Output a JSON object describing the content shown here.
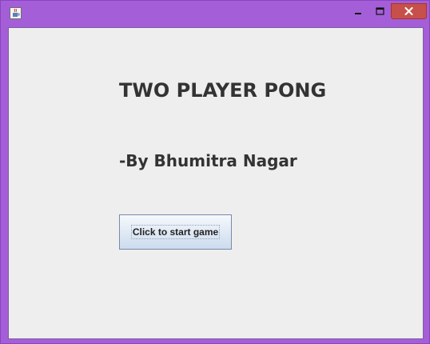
{
  "window": {
    "title": "",
    "icon": "java-cup-icon",
    "controls": {
      "minimize_glyph": "–",
      "maximize_glyph": "□",
      "close_glyph": "✕"
    }
  },
  "main": {
    "heading": "TWO PLAYER PONG",
    "author": "-By Bhumitra Nagar",
    "start_button_label": "Click to start game"
  },
  "colors": {
    "window_frame": "#a45fd8",
    "close_button": "#c7504a",
    "content_background": "#eeeeee",
    "text": "#333333"
  }
}
